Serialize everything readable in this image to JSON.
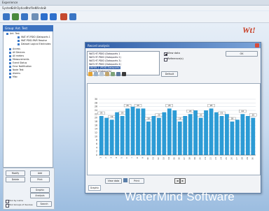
{
  "window": {
    "title": "Experience"
  },
  "menu": [
    "System",
    "Edit",
    "Options",
    "Profiles",
    "Window",
    "?"
  ],
  "tree": {
    "header": "Group: Ant. Test",
    "items": [
      {
        "label": "Ant. Test"
      },
      {
        "label": "WAT-HT-PDID (Dataports 1"
      },
      {
        "label": "WAT-PDID-PAIR Resolve"
      },
      {
        "label": "Dataset Logical Electrodes"
      },
      {
        "label": "Access"
      },
      {
        "label": "All Devices"
      },
      {
        "label": "All meters"
      },
      {
        "label": "Measurements"
      },
      {
        "label": "Event Status"
      },
      {
        "label": "Error Notification"
      },
      {
        "label": "Node Test"
      },
      {
        "label": "Alarms"
      },
      {
        "label": "Misc"
      }
    ]
  },
  "left_buttons": {
    "modify": "Modify",
    "add": "Add",
    "delete": "Delete",
    "print": "Print",
    "graphic": "Graphic",
    "analysis": "Analysis",
    "option1": "Tool by name",
    "option2": "Tool Groups of devices",
    "search": "Search"
  },
  "dialog": {
    "title": "Record analysis",
    "series_list": [
      "WAT-HT-PDID (Dataports 1",
      "WAT-HT-PDID (Dataports 2)",
      "WAT-HT-PDID (Dataports 3)",
      "WAT-HT-PDID (Dataports 4)",
      "DRYER-1 (PDID-Dataports)",
      "FS-Info (Dataports)"
    ],
    "options": {
      "view_data": "View data",
      "reference": "Reference(s)"
    },
    "ok_label": "OK",
    "default_label": "Default",
    "view_data_button": "View data",
    "print_button": "Print",
    "tab_label": "Graphic"
  },
  "chart_data": {
    "type": "bar",
    "categories": [
      "1",
      "2",
      "3",
      "4",
      "5",
      "6",
      "7",
      "8",
      "9",
      "10",
      "11",
      "12",
      "13",
      "14",
      "15",
      "16",
      "17",
      "18",
      "19",
      "20",
      "21",
      "22",
      "23",
      "24",
      "25",
      "26",
      "27",
      "28",
      "29",
      "30"
    ],
    "values": [
      21,
      20,
      19,
      23,
      21,
      25,
      26,
      25,
      25,
      18,
      21,
      20,
      23,
      25,
      24,
      18,
      21,
      22,
      24,
      20,
      24,
      25,
      23,
      21,
      22,
      18,
      19,
      22,
      21,
      20
    ],
    "ylim": [
      0,
      30
    ],
    "yticks": [
      0,
      2,
      4,
      6,
      8,
      10,
      12,
      14,
      16,
      18,
      20,
      22,
      24,
      26,
      28,
      30
    ],
    "label_flags": [
      1,
      0,
      1,
      0,
      1,
      1,
      0,
      1,
      0,
      1,
      0,
      1,
      0,
      1,
      0,
      1,
      0,
      1,
      0,
      1,
      0,
      1,
      0,
      1,
      0,
      1,
      0,
      1,
      0,
      1
    ],
    "bar_color": "#2c9bd5",
    "grid": true
  },
  "brand": {
    "footer": "WaterMind Software"
  },
  "colors": {
    "accent": "#3b72c0",
    "logo_red": "#c73a20"
  }
}
